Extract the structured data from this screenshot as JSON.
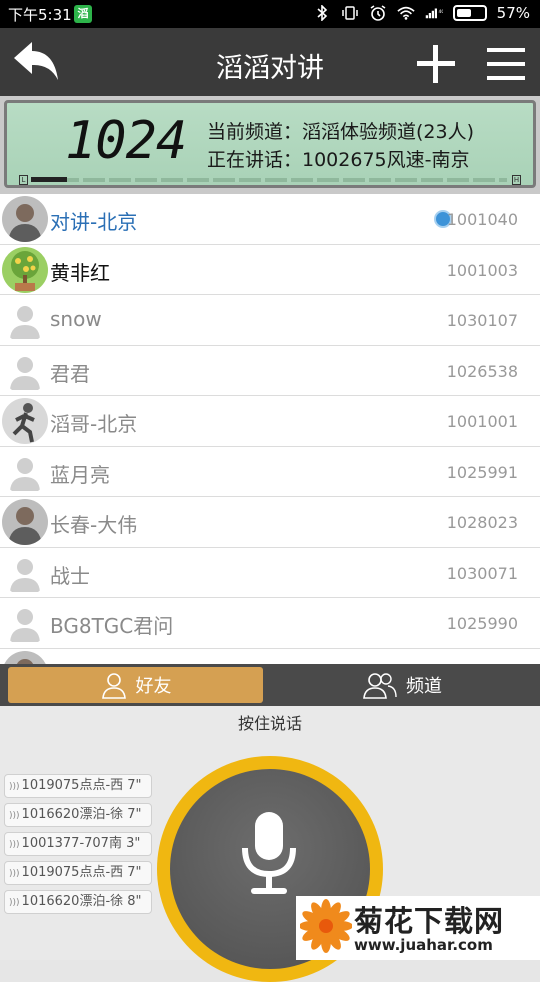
{
  "status_bar": {
    "time": "下午5:31",
    "app_badge": "滔",
    "battery": "57%",
    "battery_level": 0.57
  },
  "header": {
    "title": "滔滔对讲"
  },
  "lcd": {
    "channel_number": "1024",
    "current_channel": "当前频道：滔滔体验频道(23人)",
    "speaking": "正在讲话：1002675风速-南京",
    "meter_left": "L",
    "meter_right": "H",
    "meter_level": 0.05
  },
  "contacts": [
    {
      "name": "对讲-北京",
      "id": "1001040",
      "state": "active",
      "avatar": "photo-avatar"
    },
    {
      "name": "黄非红",
      "id": "1001003",
      "state": "online",
      "avatar": "tree-avatar"
    },
    {
      "name": "snow",
      "id": "1030107",
      "state": "offline",
      "avatar": "default-avatar"
    },
    {
      "name": "君君",
      "id": "1026538",
      "state": "offline",
      "avatar": "default-avatar"
    },
    {
      "name": "滔哥-北京",
      "id": "1001001",
      "state": "offline",
      "avatar": "runner-avatar"
    },
    {
      "name": "蓝月亮",
      "id": "1025991",
      "state": "offline",
      "avatar": "default-avatar"
    },
    {
      "name": "长春-大伟",
      "id": "1028023",
      "state": "offline",
      "avatar": "photo-avatar"
    },
    {
      "name": "战士",
      "id": "1030071",
      "state": "offline",
      "avatar": "default-avatar"
    },
    {
      "name": "BG8TGC君问",
      "id": "1025990",
      "state": "offline",
      "avatar": "default-avatar"
    }
  ],
  "tabs": [
    {
      "label": "好友",
      "icon": "person-icon",
      "selected": true
    },
    {
      "label": "频道",
      "icon": "group-icon",
      "selected": false
    }
  ],
  "ptt": {
    "hint": "按住说话",
    "history": [
      "1019075点点-西 7\"",
      "1016620漂泊-徐 7\"",
      "1001377-707南 3\"",
      "1019075点点-西 7\"",
      "1016620漂泊-徐 8\""
    ]
  },
  "watermark": {
    "title": "菊花下载网",
    "url": "www.juahar.com"
  },
  "colors": {
    "header_bg": "#3a3a3a",
    "lcd_bg": "#b1d7bd",
    "tab_selected": "#d5a052",
    "ptt_ring": "#f0b711",
    "active_name": "#2a6fb5"
  }
}
